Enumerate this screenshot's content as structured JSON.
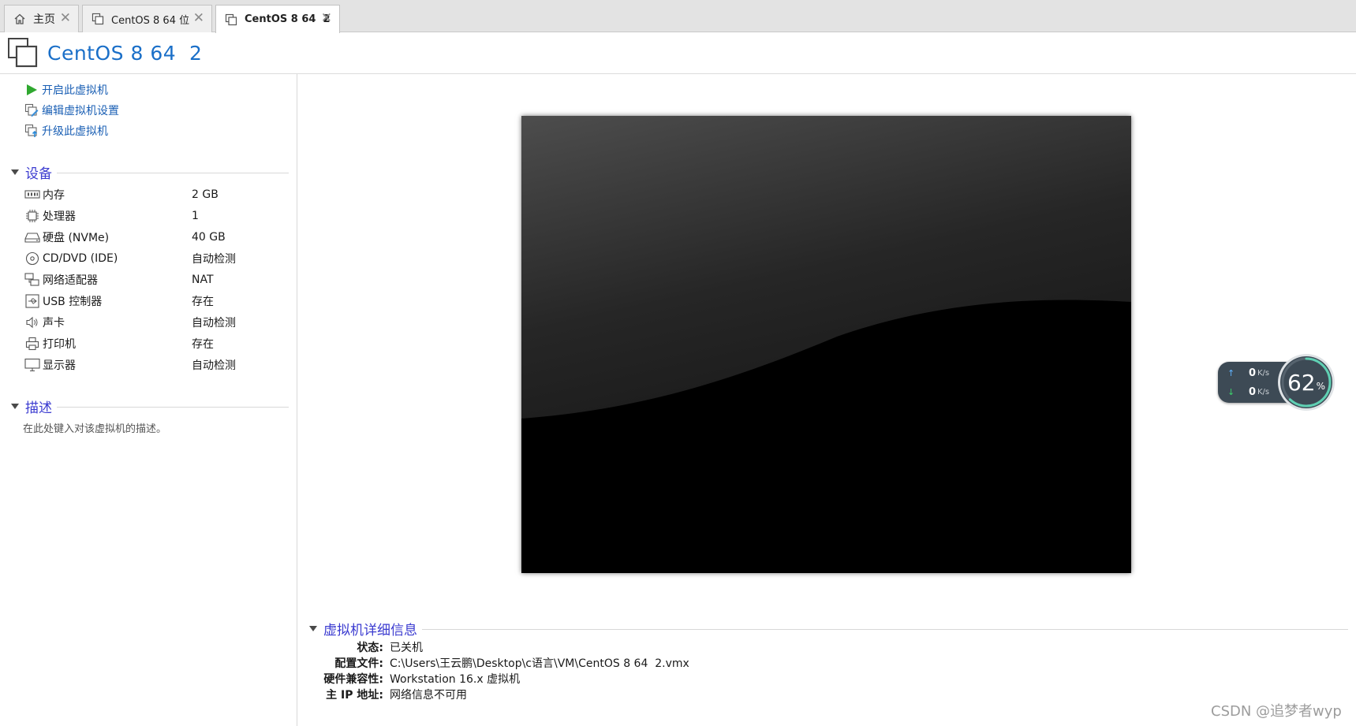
{
  "tabs": [
    {
      "label": "主页",
      "icon": "home-icon",
      "active": false
    },
    {
      "label": "CentOS 8 64 位",
      "icon": "vm-icon",
      "active": false
    },
    {
      "label": "CentOS 8 64  2",
      "icon": "vm-icon",
      "active": true
    }
  ],
  "vm_title": "CentOS 8 64  2",
  "actions": {
    "power_on": "开启此虚拟机",
    "edit_settings": "编辑虚拟机设置",
    "upgrade": "升级此虚拟机"
  },
  "devices_section": "设备",
  "devices": [
    {
      "name": "内存",
      "value": "2 GB",
      "icon": "memory-icon"
    },
    {
      "name": "处理器",
      "value": "1",
      "icon": "cpu-icon"
    },
    {
      "name": "硬盘 (NVMe)",
      "value": "40 GB",
      "icon": "disk-icon"
    },
    {
      "name": "CD/DVD (IDE)",
      "value": "自动检测",
      "icon": "cd-icon"
    },
    {
      "name": "网络适配器",
      "value": "NAT",
      "icon": "network-icon"
    },
    {
      "name": "USB 控制器",
      "value": "存在",
      "icon": "usb-icon"
    },
    {
      "name": "声卡",
      "value": "自动检测",
      "icon": "speaker-icon"
    },
    {
      "name": "打印机",
      "value": "存在",
      "icon": "printer-icon"
    },
    {
      "name": "显示器",
      "value": "自动检测",
      "icon": "monitor-icon"
    }
  ],
  "description_section": "描述",
  "description_placeholder": "在此处键入对该虚拟机的描述。",
  "net_widget": {
    "upload_value": "0",
    "upload_unit": "K/s",
    "download_value": "0",
    "download_unit": "K/s",
    "gauge_percent": "62",
    "gauge_symbol": "%",
    "gauge_fraction": 0.62,
    "colors": {
      "up": "#5fb3ff",
      "down": "#3dd26b",
      "ring": "#5fd0b3"
    }
  },
  "details_section": "虚拟机详细信息",
  "details": [
    {
      "key": "状态:",
      "value": "已关机"
    },
    {
      "key": "配置文件:",
      "value": "C:\\Users\\王云鹏\\Desktop\\c语言\\VM\\CentOS 8 64  2.vmx"
    },
    {
      "key": "硬件兼容性:",
      "value": "Workstation 16.x 虚拟机"
    },
    {
      "key": "主 IP 地址:",
      "value": "网络信息不可用"
    }
  ],
  "watermark": "CSDN @追梦者wyp",
  "colors": {
    "accent": "#1a6fc8",
    "section": "#3b3bd0",
    "link": "#1a5fb4"
  }
}
